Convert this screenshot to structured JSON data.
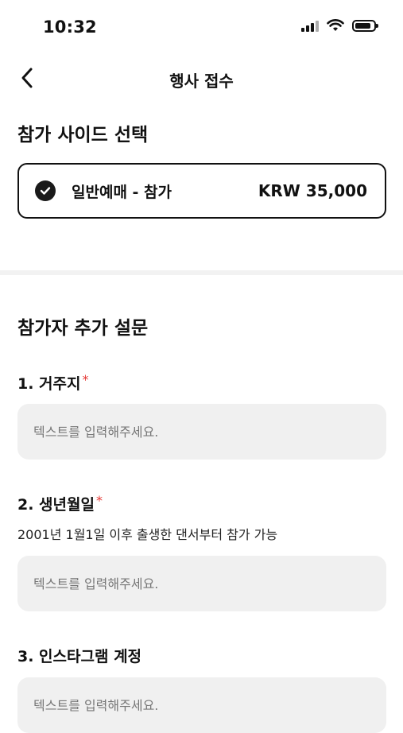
{
  "status_bar": {
    "time": "10:32"
  },
  "nav": {
    "title": "행사 접수"
  },
  "ticket_section": {
    "title": "참가 사이드 선택",
    "option": {
      "name": "일반예매 - 참가",
      "price": "KRW 35,000",
      "selected": true
    }
  },
  "survey": {
    "title": "참가자 추가 설문",
    "questions": [
      {
        "number_label": "1. 거주지",
        "required_mark": "*",
        "description": "",
        "placeholder": "텍스트를 입력해주세요."
      },
      {
        "number_label": "2. 생년월일",
        "required_mark": "*",
        "description": "2001년 1월1일 이후 출생한 댄서부터 참가 가능",
        "placeholder": "텍스트를 입력해주세요."
      },
      {
        "number_label": "3. 인스타그램 계정",
        "required_mark": "",
        "description": "",
        "placeholder": "텍스트를 입력해주세요."
      }
    ]
  },
  "colors": {
    "required": "#e53935",
    "input_bg": "#f0f0f0",
    "border": "#111111"
  }
}
